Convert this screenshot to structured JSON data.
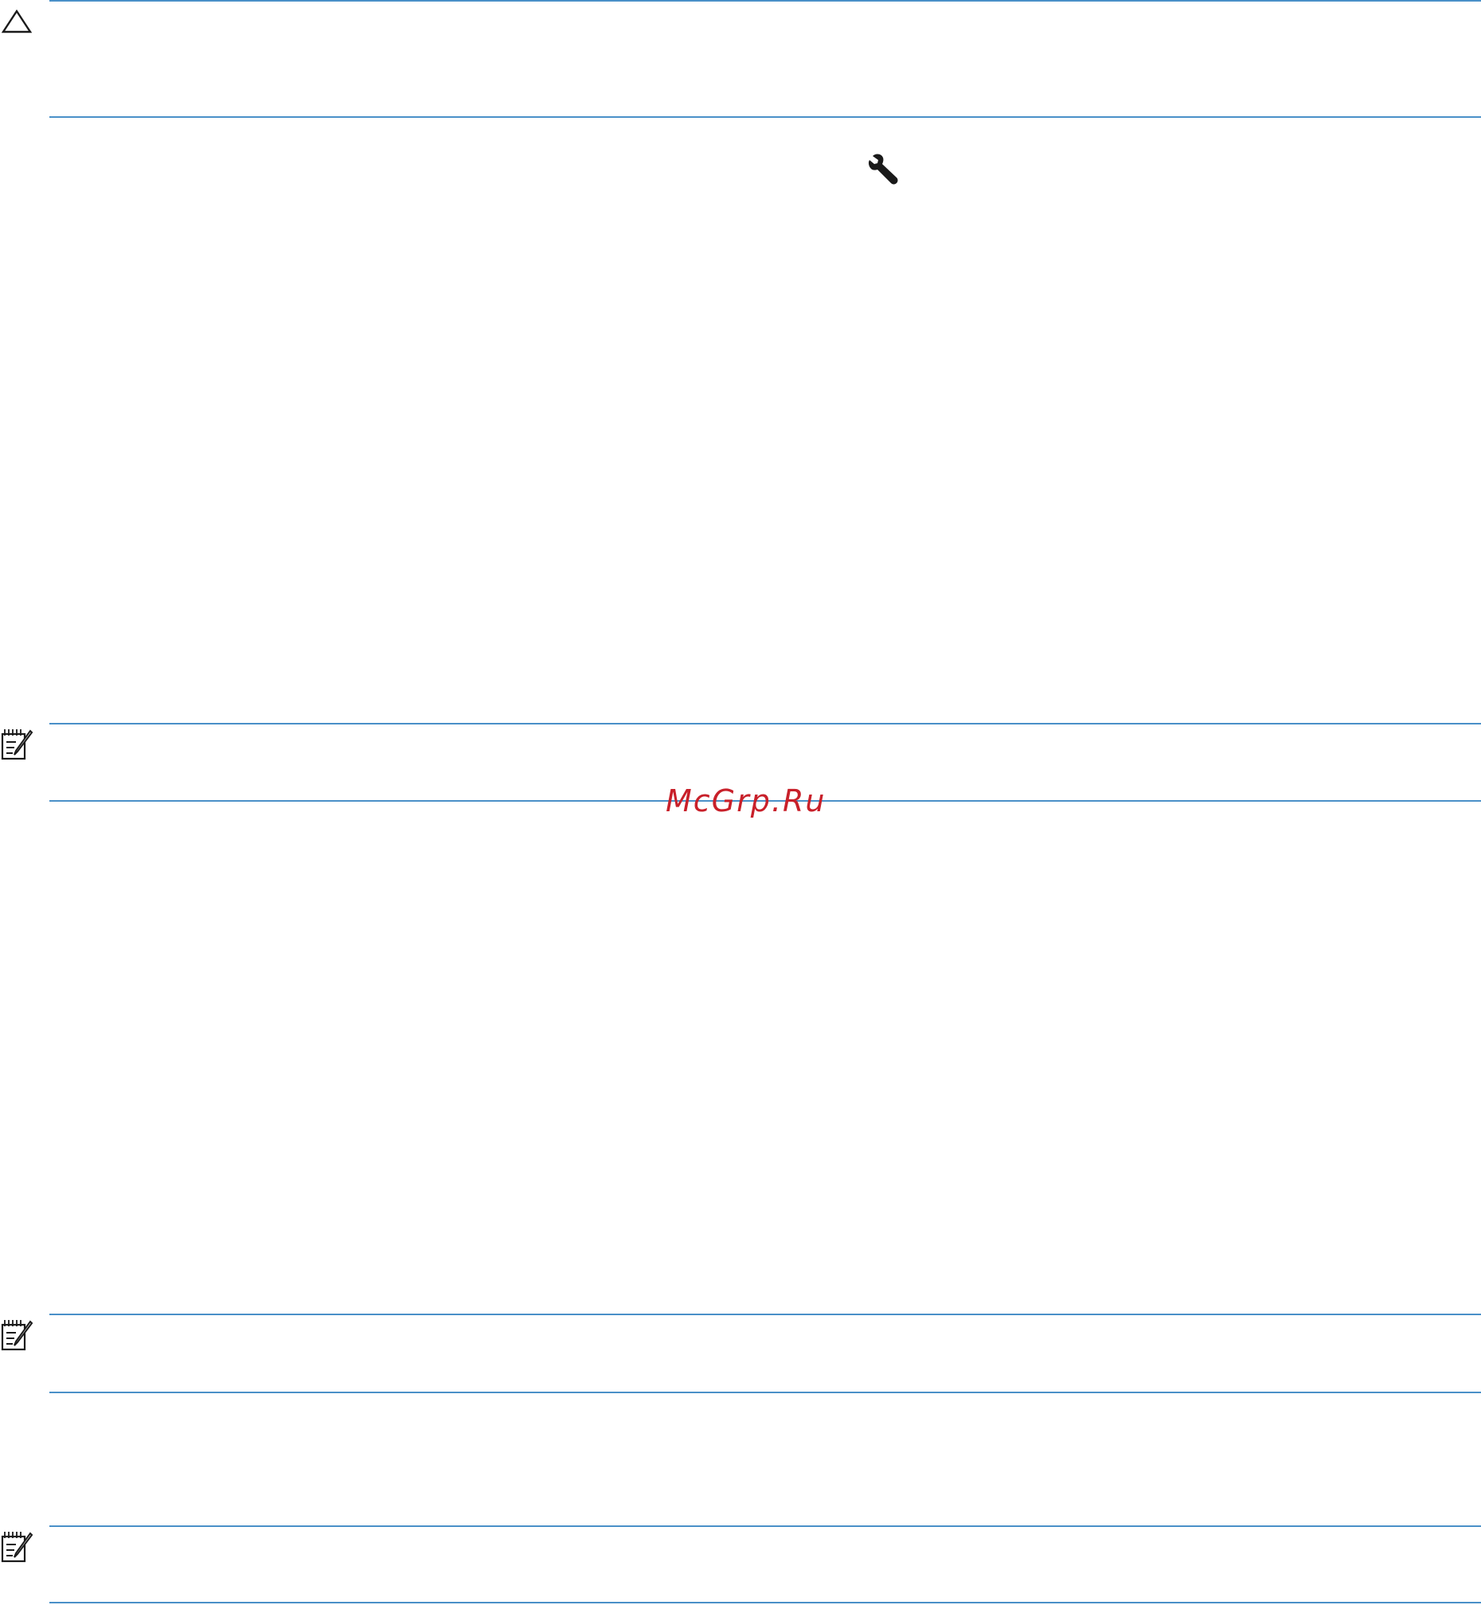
{
  "page": {
    "background": "#ffffff",
    "rule_color": "#4a90c8"
  },
  "callouts": [
    {
      "kind": "caution",
      "icon": "caution-triangle-icon"
    },
    {
      "kind": "note",
      "icon": "note-pad-icon"
    },
    {
      "kind": "note",
      "icon": "note-pad-icon"
    },
    {
      "kind": "note",
      "icon": "note-pad-icon"
    }
  ],
  "inline_icons": [
    {
      "icon": "wrench-icon"
    }
  ],
  "watermark": {
    "text": "McGrp.Ru",
    "color": "#c8202a"
  }
}
